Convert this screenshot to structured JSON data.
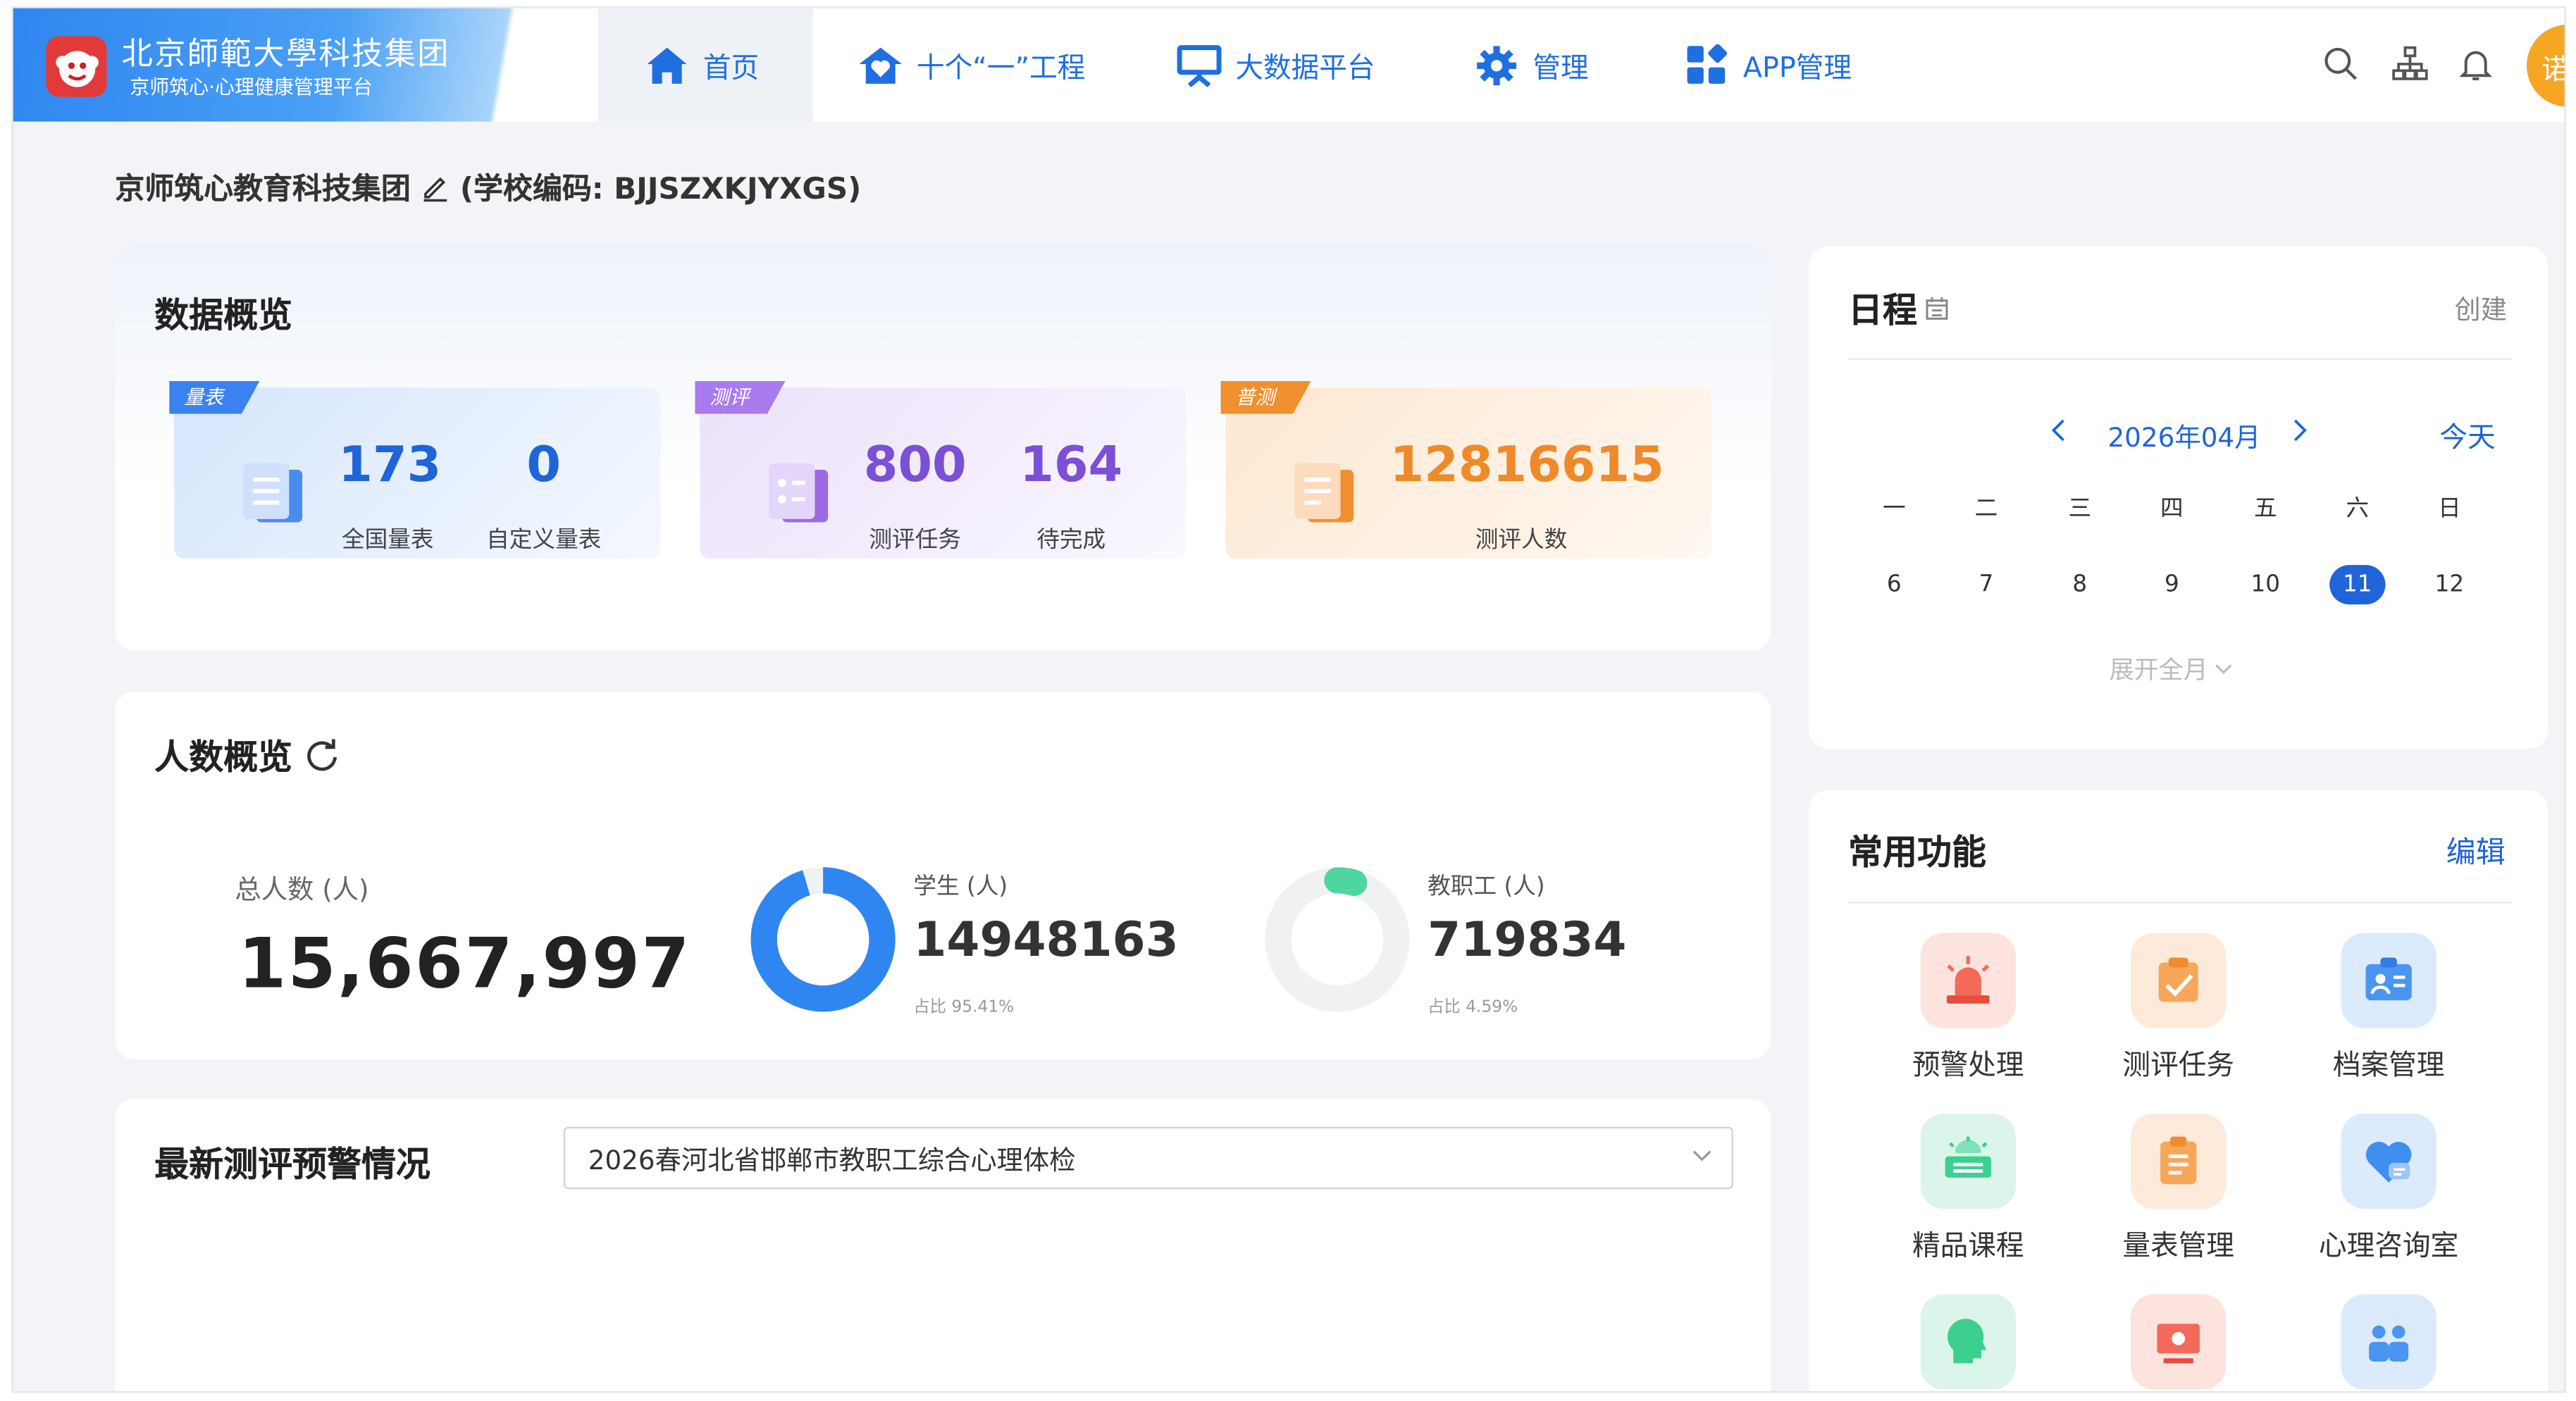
{
  "header": {
    "brand_title": "北京師範大學科技集团",
    "brand_subtitle": "京师筑心·心理健康管理平台",
    "nav": [
      {
        "label": "首页",
        "icon": "home-icon",
        "active": true
      },
      {
        "label": "十个“一”工程",
        "icon": "heart-house-icon",
        "active": false
      },
      {
        "label": "大数据平台",
        "icon": "presentation-icon",
        "active": false
      },
      {
        "label": "管理",
        "icon": "gear-icon",
        "active": false
      },
      {
        "label": "APP管理",
        "icon": "app-grid-icon",
        "active": false
      }
    ],
    "avatar_text": "诺"
  },
  "school": {
    "name": "京师筑心教育科技集团",
    "code_text": "(学校编码: BJJSZXKJYXGS)"
  },
  "overview": {
    "title": "数据概览",
    "cards": [
      {
        "tag": "量表",
        "items": [
          {
            "value": "173",
            "label": "全国量表"
          },
          {
            "value": "0",
            "label": "自定义量表"
          }
        ]
      },
      {
        "tag": "测评",
        "items": [
          {
            "value": "800",
            "label": "测评任务"
          },
          {
            "value": "164",
            "label": "待完成"
          }
        ]
      },
      {
        "tag": "普测",
        "items": [
          {
            "value": "12816615",
            "label": "测评人数"
          }
        ]
      }
    ]
  },
  "people": {
    "title": "人数概览",
    "total_label": "总人数 (人)",
    "total_value": "15,667,997",
    "students": {
      "label": "学生 (人)",
      "value": "14948163",
      "ratio_text": "占比 95.41%",
      "ratio": 0.9541
    },
    "staff": {
      "label": "教职工 (人)",
      "value": "719834",
      "ratio_text": "占比 4.59%",
      "ratio": 0.0459
    }
  },
  "alerts": {
    "title": "最新测评预警情况",
    "selected": "2026春河北省邯郸市教职工综合心理体检"
  },
  "schedule": {
    "title": "日程",
    "create": "创建",
    "month": "2026年04月",
    "today": "今天",
    "weekdays": [
      "一",
      "二",
      "三",
      "四",
      "五",
      "六",
      "日"
    ],
    "days": [
      "6",
      "7",
      "8",
      "9",
      "10",
      "11",
      "12"
    ],
    "current_day": "11",
    "expand": "展开全月"
  },
  "functions": {
    "title": "常用功能",
    "edit": "编辑",
    "items": [
      {
        "label": "预警处理",
        "icon": "alarm-icon",
        "color": "#fde3de"
      },
      {
        "label": "测评任务",
        "icon": "task-icon",
        "color": "#fdeadb"
      },
      {
        "label": "档案管理",
        "icon": "archive-icon",
        "color": "#dcebfb"
      },
      {
        "label": "精品课程",
        "icon": "course-icon",
        "color": "#dcf5ea"
      },
      {
        "label": "量表管理",
        "icon": "scale-icon",
        "color": "#fdeadb"
      },
      {
        "label": "心理咨询室",
        "icon": "consult-heart-icon",
        "color": "#dcebfb"
      },
      {
        "label": "",
        "icon": "head-icon",
        "color": "#dcf5ea"
      },
      {
        "label": "",
        "icon": "monitor-icon",
        "color": "#fde3de"
      },
      {
        "label": "",
        "icon": "group-icon",
        "color": "#dcebfb"
      }
    ]
  }
}
